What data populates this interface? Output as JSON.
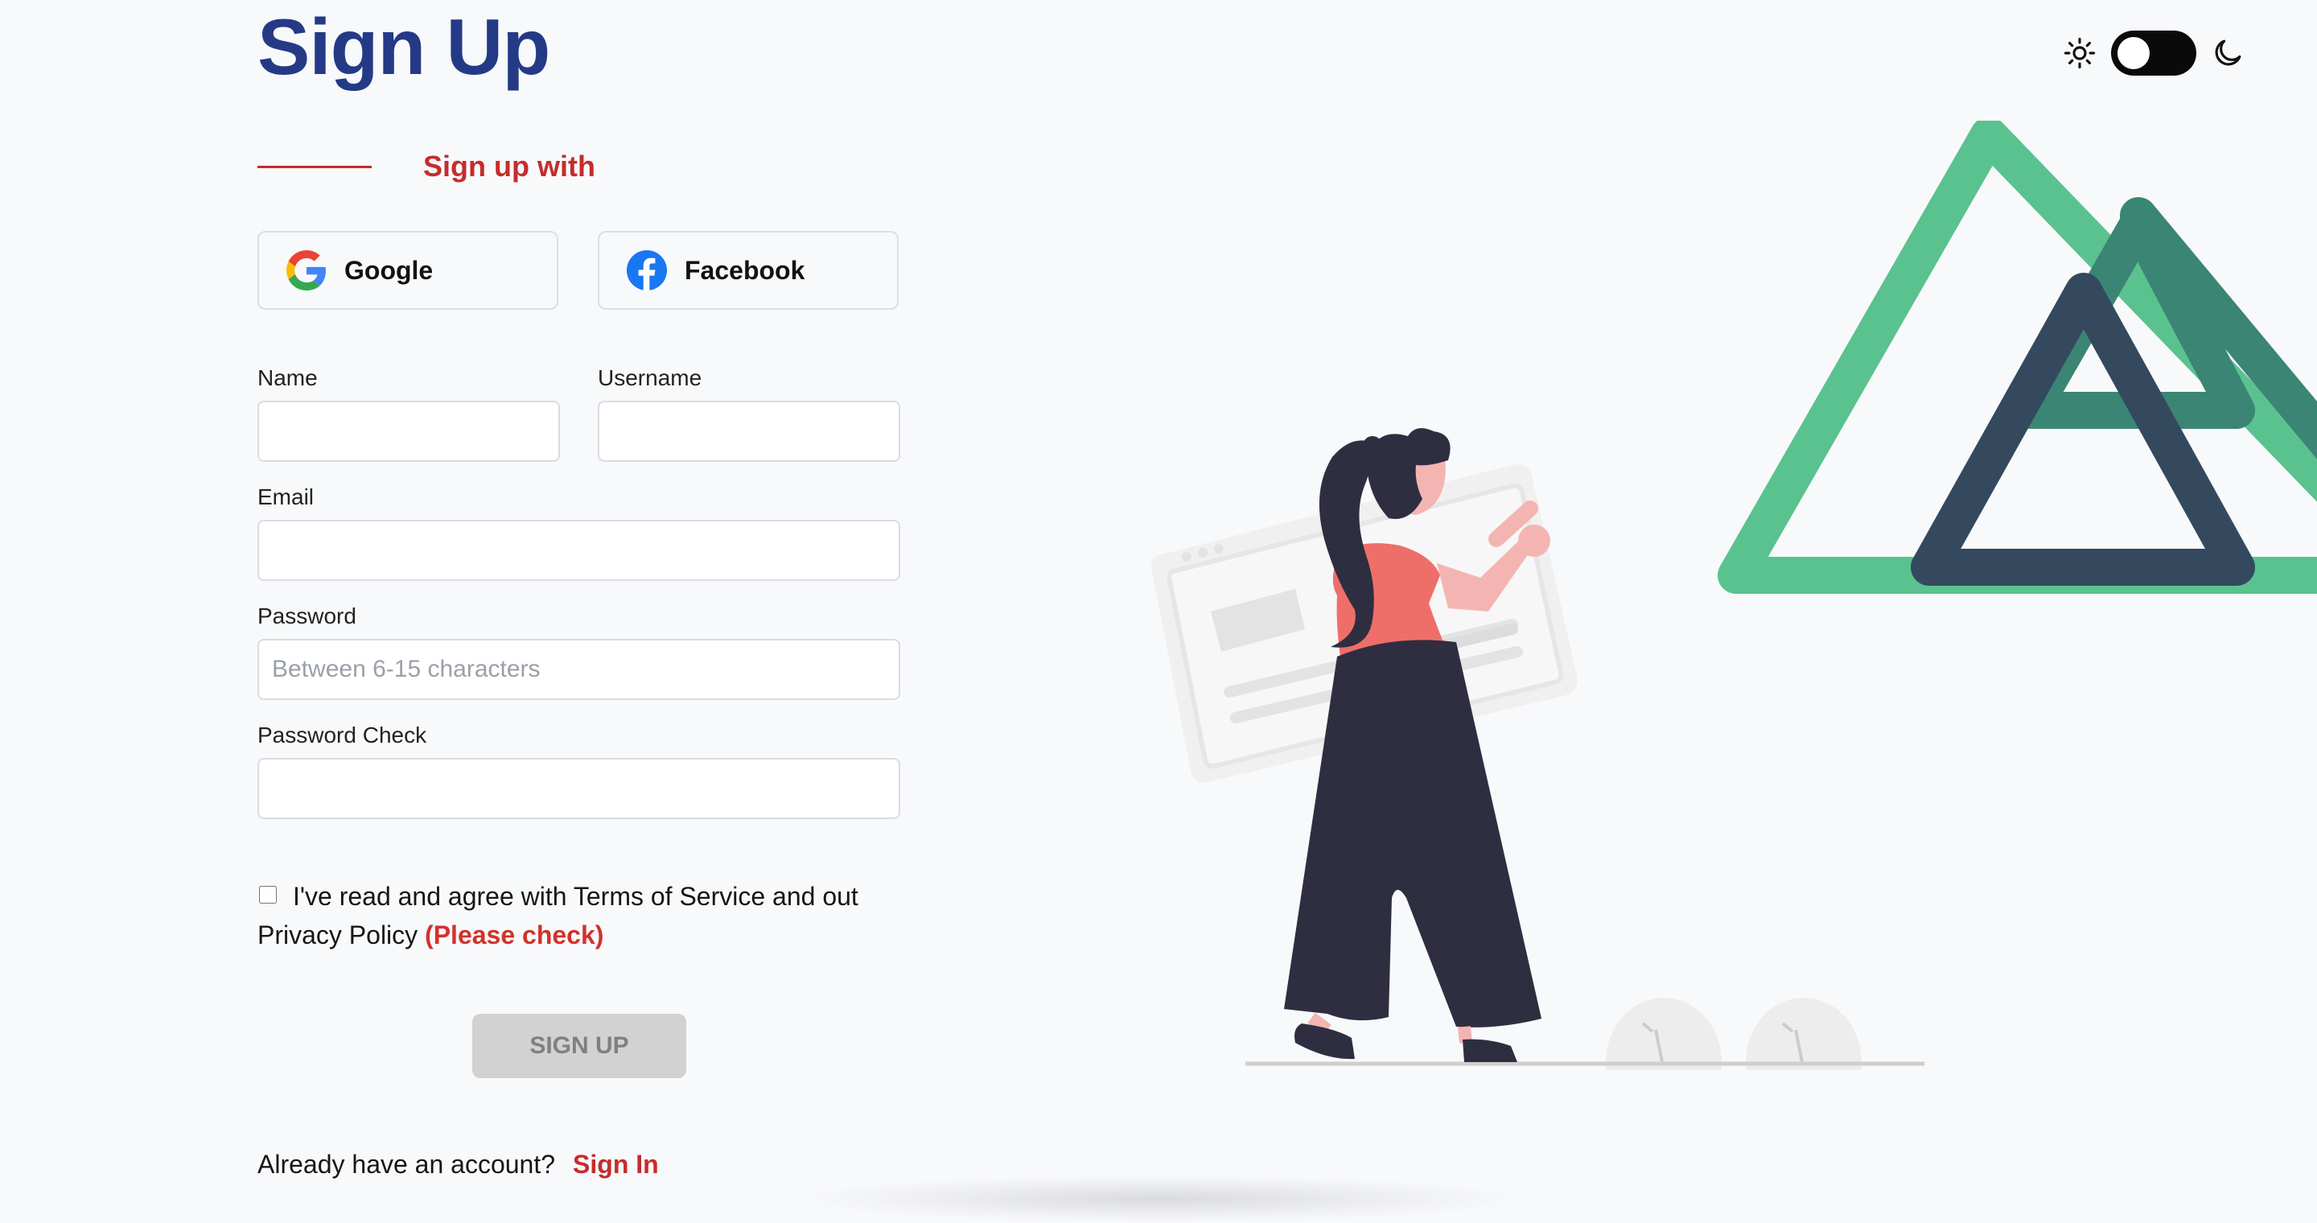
{
  "page": {
    "title": "Sign Up"
  },
  "theme_toggle": {
    "light_icon": "sun-icon",
    "dark_icon": "moon-icon",
    "state": "light"
  },
  "social": {
    "divider_label": "Sign up with",
    "google_label": "Google",
    "facebook_label": "Facebook"
  },
  "form": {
    "name": {
      "label": "Name",
      "value": "",
      "placeholder": ""
    },
    "username": {
      "label": "Username",
      "value": "",
      "placeholder": ""
    },
    "email": {
      "label": "Email",
      "value": "",
      "placeholder": ""
    },
    "password": {
      "label": "Password",
      "value": "",
      "placeholder": "Between 6-15 characters"
    },
    "password_check": {
      "label": "Password Check",
      "value": "",
      "placeholder": ""
    }
  },
  "agreement": {
    "text": "I've read and agree with Terms of Service and out Privacy Policy",
    "warning": "(Please check)",
    "checked": false
  },
  "submit": {
    "label": "SIGN UP"
  },
  "footer": {
    "prompt": "Already have an account?",
    "link": "Sign In"
  },
  "colors": {
    "title": "#253a86",
    "accent": "#c62c2c",
    "warning": "#d1322b",
    "vue_green": "#5ac28f",
    "vue_dark_green": "#3b8574",
    "vue_navy": "#34495e",
    "illustration_shirt": "#ee6e6a",
    "illustration_dark": "#2f2e41"
  }
}
